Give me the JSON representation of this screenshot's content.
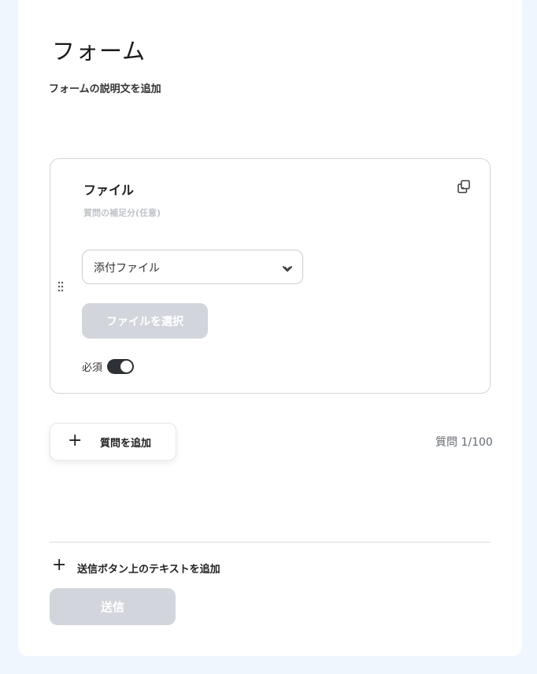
{
  "form": {
    "title": "フォーム",
    "description_placeholder": "フォームの説明文を追加"
  },
  "question": {
    "title": "ファイル",
    "supplement_placeholder": "質問の補足分(任意)",
    "type_selected": "添付ファイル",
    "file_button_label": "ファイルを選択",
    "required_label": "必須",
    "required_on": true
  },
  "actions": {
    "add_question_label": "質問を追加",
    "question_count": "質問 1/100",
    "add_submit_text_label": "送信ボタン上のテキストを追加",
    "submit_label": "送信"
  },
  "icons": {
    "copy": "copy-icon",
    "drag": "drag-handle-icon",
    "chevron": "chevron-down-icon",
    "plus": "plus-icon"
  },
  "colors": {
    "page_background": "#eff6fe",
    "disabled_button": "#d2d6dc",
    "toggle_on": "#2d3035",
    "card_border": "#d3d5d9"
  }
}
